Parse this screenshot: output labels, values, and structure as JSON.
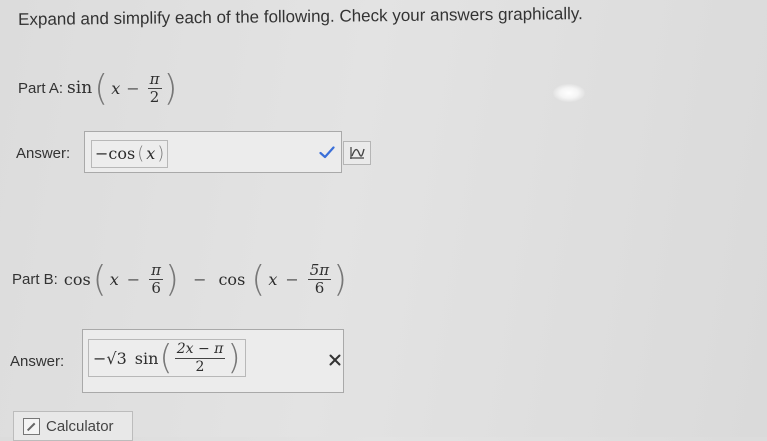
{
  "instructions": "Expand and simplify each of the following. Check your answers graphically.",
  "partA": {
    "label": "Part A:",
    "fn": "sin",
    "var": "x",
    "minus": "−",
    "num": "π",
    "den": "2",
    "answer_label": "Answer:",
    "answer_text": "−cos",
    "answer_var": "x",
    "status": "correct",
    "status_icon": "checkmark-icon",
    "graph_icon": "graph-icon",
    "colors": {
      "correct": "#3a6fd8"
    }
  },
  "partB": {
    "label": "Part B:",
    "fn": "cos",
    "var": "x",
    "minus": "−",
    "num1": "π",
    "den1": "6",
    "num2": "5π",
    "den2": "6",
    "answer_label": "Answer:",
    "answer_coef": "−√3",
    "answer_fn": "sin",
    "answer_num": "2x − π",
    "answer_den": "2",
    "status": "incorrect",
    "status_icon": "cross-icon"
  },
  "calculator": {
    "label": "Calculator"
  }
}
